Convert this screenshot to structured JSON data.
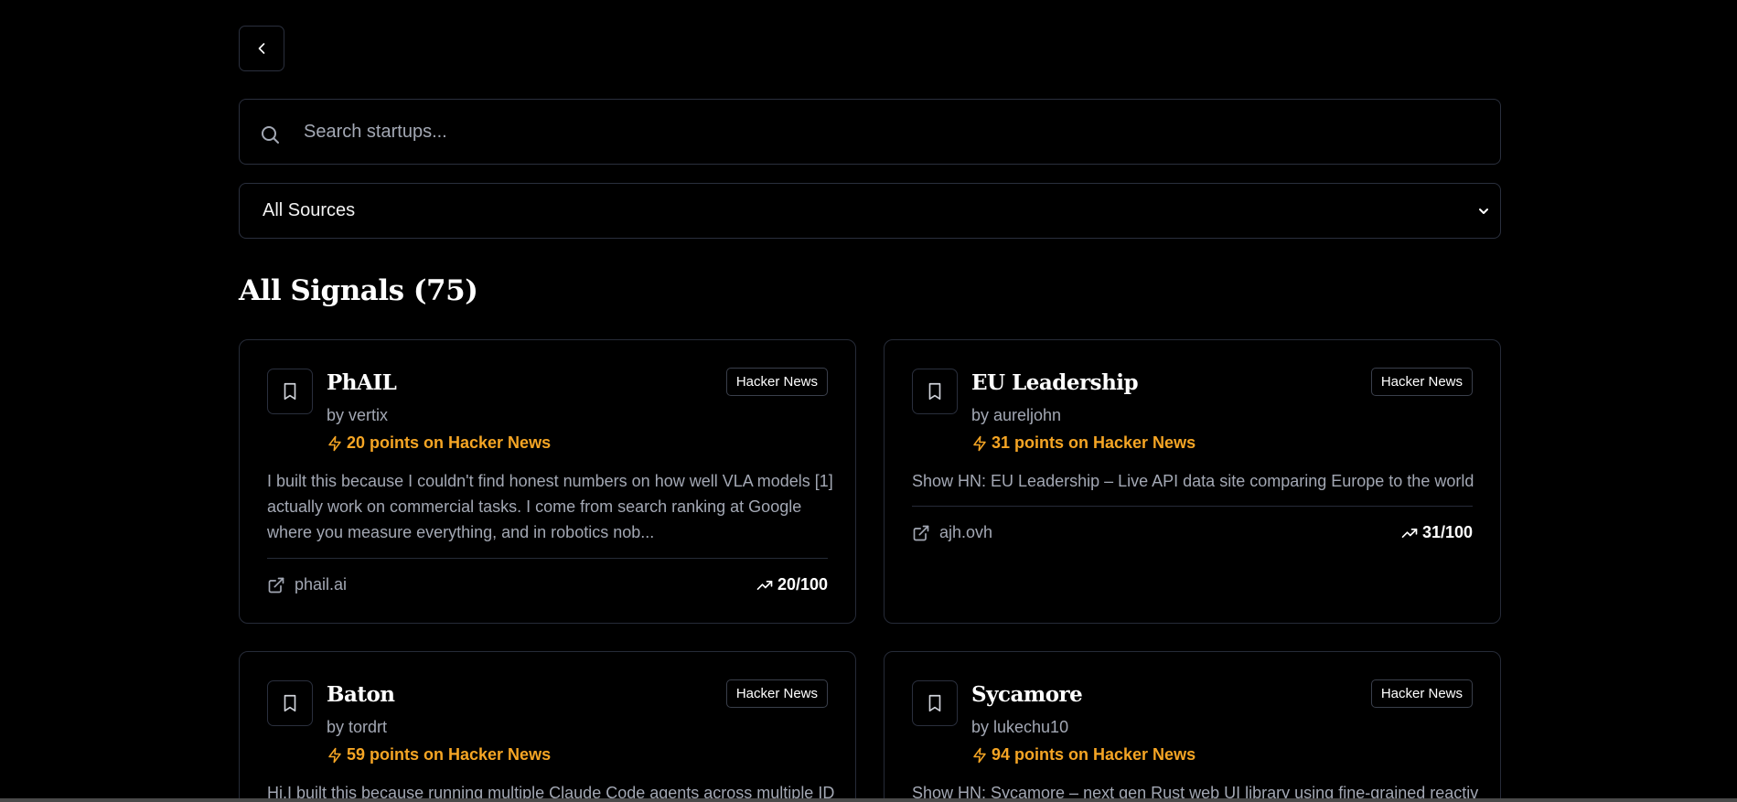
{
  "search": {
    "placeholder": "Search startups..."
  },
  "filter": {
    "selected": "All Sources"
  },
  "section": {
    "title": "All Signals (75)"
  },
  "cards": [
    {
      "title": "PhAIL",
      "source": "Hacker News",
      "by_label": "by",
      "author": "vertix",
      "points": "20 points on Hacker News",
      "description": "I built this because I couldn't find honest numbers on how well VLA models [1] actually work on commercial tasks. I come from search ranking at Google where you measure everything, and in robotics nob...",
      "domain": "phail.ai",
      "score": "20/100"
    },
    {
      "title": "EU Leadership",
      "source": "Hacker News",
      "by_label": "by",
      "author": "aureljohn",
      "points": "31 points on Hacker News",
      "description": "Show HN: EU Leadership – Live API data site comparing Europe to the world",
      "domain": "ajh.ovh",
      "score": "31/100"
    },
    {
      "title": "Baton",
      "source": "Hacker News",
      "by_label": "by",
      "author": "tordrt",
      "points": "59 points on Hacker News",
      "description": "Hi,I built this because running multiple Claude Code agents across multiple IDE"
    },
    {
      "title": "Sycamore",
      "source": "Hacker News",
      "by_label": "by",
      "author": "lukechu10",
      "points": "94 points on Hacker News",
      "description": "Show HN: Sycamore – next gen Rust web UI library using fine-grained reactivity"
    }
  ]
}
